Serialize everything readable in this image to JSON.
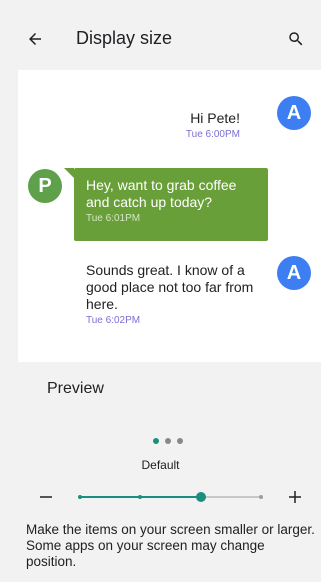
{
  "header": {
    "title": "Display size",
    "back_icon": "arrow-back-icon",
    "search_icon": "search-icon"
  },
  "preview": {
    "label": "Preview",
    "messages": [
      {
        "avatar_letter": "A",
        "avatar_color": "#3d7ff2",
        "text": "Hi Pete!",
        "time": "Tue 6:00PM"
      },
      {
        "avatar_letter": "P",
        "avatar_color": "#5fa04b",
        "text": "Hey, want to grab coffee and catch up today?",
        "time": "Tue 6:01PM"
      },
      {
        "avatar_letter": "A",
        "avatar_color": "#3d7ff2",
        "text": "Sounds great. I know of a good place not too far from here.",
        "time": "Tue 6:02PM"
      }
    ]
  },
  "size_control": {
    "level_label": "Default",
    "levels": 4,
    "current_level": 2,
    "minus_label": "−",
    "plus_label": "+",
    "accent_color": "#1a8f7f"
  },
  "description": "Make the items on your screen smaller or larger. Some apps on your screen may change position."
}
